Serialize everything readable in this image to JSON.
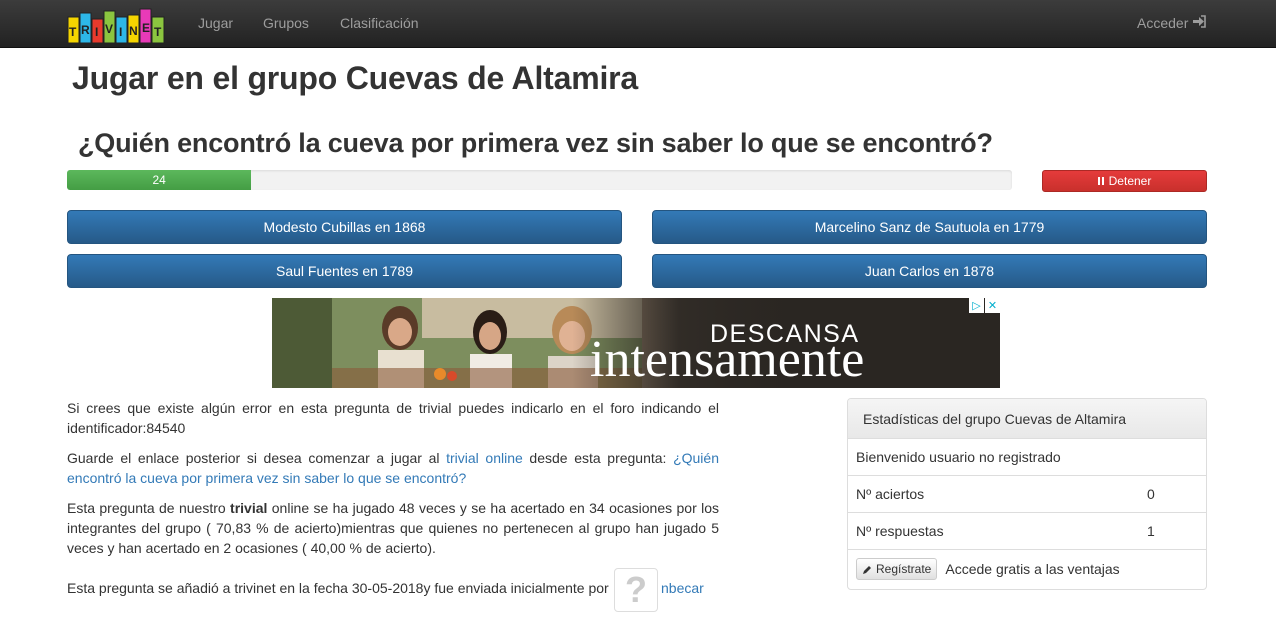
{
  "nav": {
    "logo_text": "TRIVINET",
    "jugar": "Jugar",
    "grupos": "Grupos",
    "clasificacion": "Clasificación",
    "acceder": "Acceder"
  },
  "page_title": "Jugar en el grupo Cuevas de Altamira",
  "question": "¿Quién encontró la cueva por primera vez sin saber lo que se encontró?",
  "timer": {
    "value": "24",
    "fraction": 0.195
  },
  "stop_label": "Detener",
  "answers": [
    "Modesto Cubillas en 1868",
    "Marcelino Sanz de Sautuola en 1779",
    "Saul Fuentes en 1789",
    "Juan Carlos en 1878"
  ],
  "ad": {
    "line1": "DESCANSA",
    "line2": "intensamente"
  },
  "info": {
    "error_text": "Si crees que existe algún error en esta pregunta de trivial puedes indicarlo en el foro indicando el identificador:84540",
    "link_prefix": "Guarde el enlace posterior si desea comenzar a jugar al ",
    "link_trivial": "trivial online",
    "link_middle": " desde esta pregunta: ",
    "link_question": "¿Quién encontró la cueva por primera vez sin saber lo que se encontró?",
    "stats_prefix": "Esta pregunta de nuestro ",
    "stats_bold": "trivial",
    "stats_rest": " online se ha jugado 48 veces y se ha acertado en 34 ocasiones por los integrantes del grupo ( 70,83 % de acierto)mientras que quienes no pertenecen al grupo han jugado 5 veces y han acertado en 2 ocasiones ( 40,00 % de acierto).",
    "added_text": "Esta pregunta se añadió a trivinet en la fecha 30-05-2018y fue enviada inicialmente por",
    "author": "nbecar"
  },
  "stats_panel": {
    "title": "Estadísticas del grupo Cuevas de Altamira",
    "welcome": "Bienvenido  usuario no registrado",
    "aciertos_label": "Nº aciertos",
    "aciertos_value": "0",
    "respuestas_label": "Nº respuestas",
    "respuestas_value": "1",
    "register_button": "Regístrate",
    "register_text": "Accede gratis a las ventajas"
  }
}
